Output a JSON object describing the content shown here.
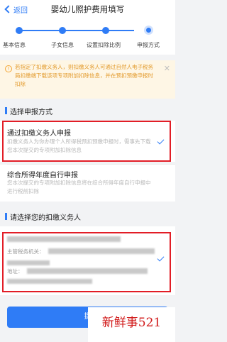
{
  "nav": {
    "back_label": "返回",
    "title": "婴幼儿照护费用填写"
  },
  "steps": [
    "基本信息",
    "子女信息",
    "设置扣除比例",
    "申报方式"
  ],
  "notice": {
    "text": "若指定了扣缴义务人，则扣缴义务人可通过自然人电子税务局扣缴端下载该项专项附加扣除信息，并在预扣预缴申报时扣除"
  },
  "section_method": {
    "title": "选择申报方式"
  },
  "options": [
    {
      "title": "通过扣缴义务人申报",
      "desc": "扣缴义务人为你办理个人所得税预扣预缴申报时，需事先下载您本次提交的专项附加扣除信息"
    },
    {
      "title": "综合所得年度自行申报",
      "desc": "您本次提交的专项附加扣除信息将在综合所得年度自行申报中进行税前扣除"
    }
  ],
  "section_agent": {
    "title": "请选择您的扣缴义务人"
  },
  "agent": {
    "authority_label": "主管税务机关：",
    "address_label": "地址："
  },
  "submit": {
    "label": "提"
  },
  "watermark": {
    "text": "新鲜事521"
  },
  "colors": {
    "accent": "#2f7cf6",
    "warning": "#e39b2d",
    "highlight": "#e21d26"
  }
}
